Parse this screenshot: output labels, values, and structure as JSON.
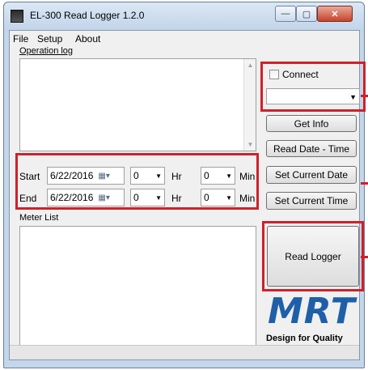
{
  "window": {
    "title": "EL-300 Read Logger 1.2.0",
    "caption_buttons": {
      "minimize": "—",
      "maximize": "▢",
      "close": "✕"
    }
  },
  "menu": {
    "items": [
      "File",
      "Setup",
      "About"
    ]
  },
  "operation_log": {
    "label": "Operation log",
    "text": ""
  },
  "connect": {
    "label": "Connect",
    "checked": false,
    "port_value": ""
  },
  "buttons": {
    "get_info": "Get Info",
    "read_date_time": "Read Date - Time",
    "set_current_date": "Set Current Date",
    "set_current_time": "Set Current Time",
    "read_logger": "Read Logger"
  },
  "start": {
    "label": "Start",
    "date": "6/22/2016",
    "hour": "0",
    "hr_label": "Hr",
    "minute": "0",
    "min_label": "Min"
  },
  "end": {
    "label": "End",
    "date": "6/22/2016",
    "hour": "0",
    "hr_label": "Hr",
    "minute": "0",
    "min_label": "Min"
  },
  "meter_list": {
    "label": "Meter List"
  },
  "logo": {
    "name": "MRT",
    "tagline": "Design for Quality",
    "color": "#1f5fa8"
  },
  "highlight_color": "#d0202a"
}
